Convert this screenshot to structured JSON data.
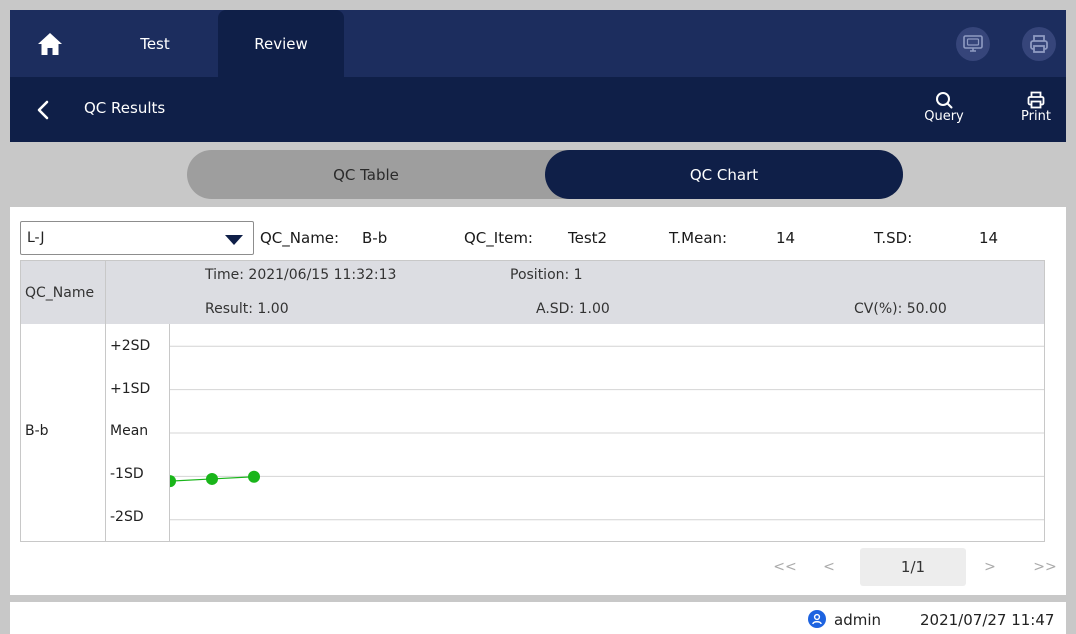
{
  "topbar": {
    "tabs": [
      {
        "label": "Test",
        "active": false
      },
      {
        "label": "Review",
        "active": true
      }
    ],
    "icons": [
      "home-icon",
      "lis-icon",
      "printer-icon"
    ]
  },
  "subbar": {
    "title": "QC Results",
    "query_label": "Query",
    "print_label": "Print"
  },
  "segments": {
    "table_label": "QC Table",
    "chart_label": "QC Chart",
    "active": "QC Chart"
  },
  "filter": {
    "chart_type": "L-J",
    "qc_name_label": "QC_Name:",
    "qc_name_value": "B-b",
    "qc_item_label": "QC_Item:",
    "qc_item_value": "Test2",
    "tmean_label": "T.Mean:",
    "tmean_value": "14",
    "tsd_label": "T.SD:",
    "tsd_value": "14"
  },
  "grid": {
    "name_header": "QC_Name",
    "time_text": "Time: 2021/06/15 11:32:13",
    "position_text": "Position: 1",
    "result_text": "Result: 1.00",
    "asd_text": "A.SD: 1.00",
    "cv_text": "CV(%): 50.00",
    "row_name": "B-b",
    "sd_levels": [
      "+2SD",
      "+1SD",
      "Mean",
      "-1SD",
      "-2SD"
    ]
  },
  "chart_data": {
    "type": "line",
    "title": "",
    "xlabel": "",
    "ylabel": "",
    "y_categories": [
      "-2SD",
      "-1SD",
      "Mean",
      "+1SD",
      "+2SD"
    ],
    "ylim": [
      -2.5,
      2.5
    ],
    "x": [
      1,
      2,
      3
    ],
    "values": [
      -1.12,
      -1.07,
      -1.02
    ],
    "color": "#19b51a",
    "grid": true
  },
  "pagination": {
    "first": "<<",
    "prev": "<",
    "page": "1/1",
    "next": ">",
    "last": ">>"
  },
  "status": {
    "user": "admin",
    "datetime": "2021/07/27 11:47"
  },
  "colors": {
    "navy": "#1c2d5e",
    "dark_navy": "#0f1f48",
    "point_green": "#19b51a",
    "user_blue": "#1d63e0"
  }
}
